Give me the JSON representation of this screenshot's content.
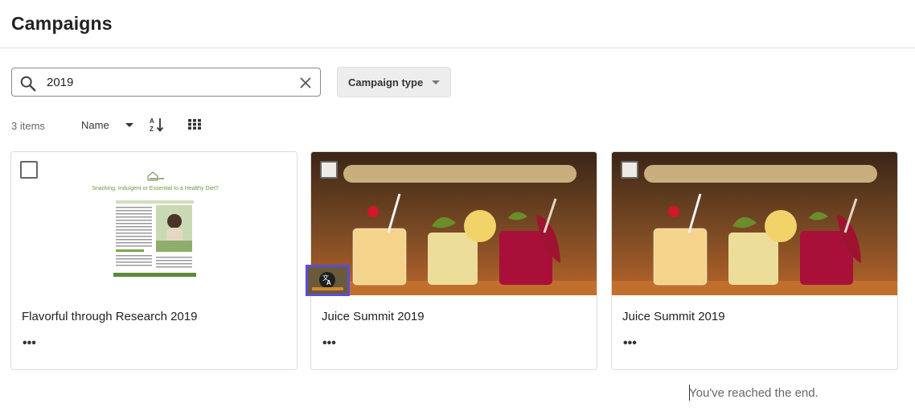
{
  "header": {
    "title": "Campaigns"
  },
  "search": {
    "value": "2019",
    "placeholder": ""
  },
  "filter": {
    "campaign_type_label": "Campaign type"
  },
  "toolbar": {
    "count": "3 items",
    "sort_label": "Name"
  },
  "cards": [
    {
      "name": "Flavorful through Research 2019",
      "more": "•••",
      "doc_heading": "Snacking: Indulgent or Essential to a Healthy Diet?"
    },
    {
      "name": "Juice Summit 2019",
      "more": "•••"
    },
    {
      "name": "Juice Summit 2019",
      "more": "•••"
    }
  ],
  "footer": {
    "end_text": "You've reached the end."
  },
  "colors": {
    "accent": "#5b4cd6",
    "doc_green": "#5c8a3a",
    "border": "#dcdcdc"
  },
  "icons": [
    "search-icon",
    "clear-icon",
    "sort-az-icon",
    "grid-view-icon",
    "translate-icon"
  ]
}
